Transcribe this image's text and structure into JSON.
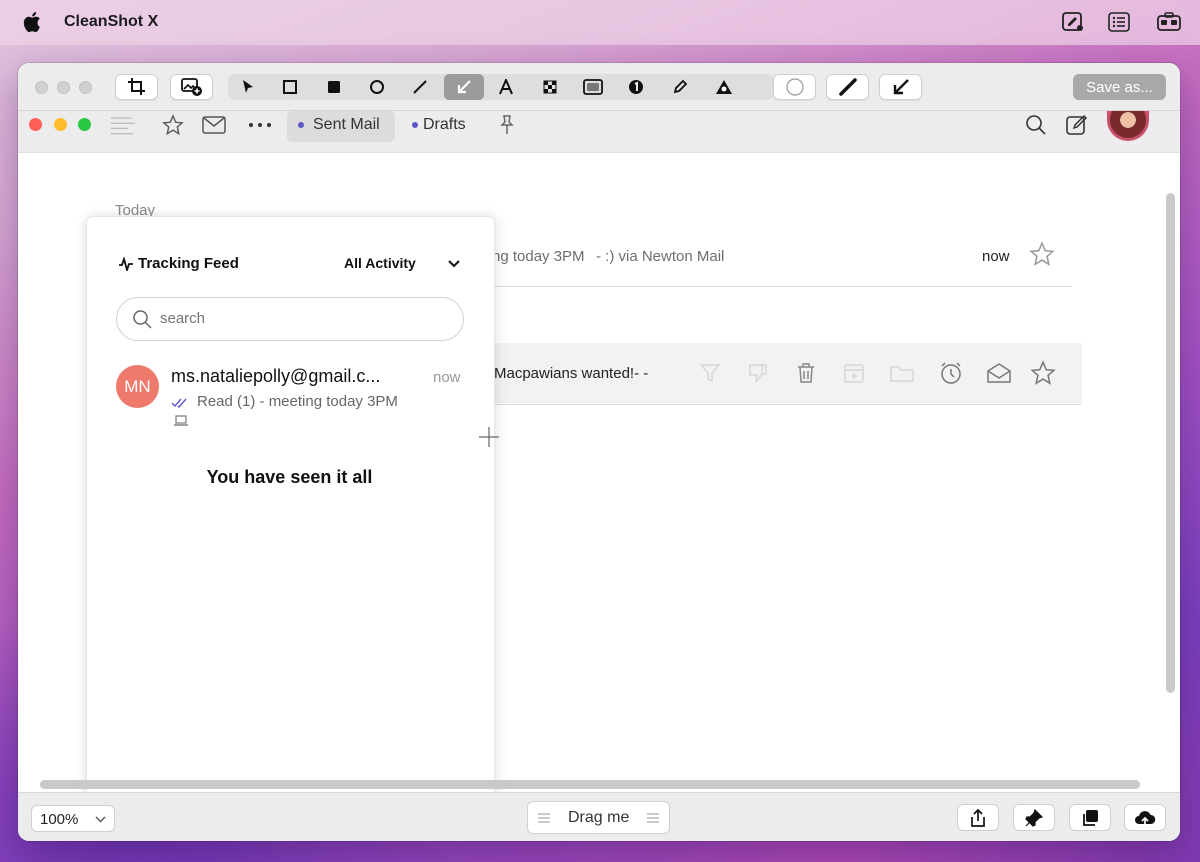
{
  "menubar": {
    "app_name": "CleanShot X",
    "icons": [
      "annotate-icon",
      "list-icon",
      "toolbox-icon"
    ]
  },
  "toolbar": {
    "tools": [
      "crop-icon",
      "add-background-icon",
      "select-arrow-icon",
      "rectangle-icon",
      "filled-rectangle-icon",
      "ellipse-icon",
      "line-icon",
      "arrow-icon",
      "text-icon",
      "pixelate-icon",
      "highlight-box-icon",
      "counter-icon",
      "pencil-icon",
      "blur-icon",
      "color-icon",
      "stroke-width-icon",
      "arrow-style-icon"
    ],
    "active_tool": "arrow-icon",
    "save_label": "Save as..."
  },
  "mail": {
    "tabs": [
      {
        "label": "Sent Mail",
        "active": true
      },
      {
        "label": "Drafts",
        "active": false
      }
    ],
    "section_label": "Today",
    "rows": [
      {
        "snippet": "ng today 3PM",
        "preview": "- :) via Newton Mail",
        "time": "now"
      },
      {
        "subject": "Macpawians wanted!- -"
      }
    ],
    "row_actions": [
      "filter-icon",
      "thumbs-down-icon",
      "trash-icon",
      "archive-icon",
      "folder-icon",
      "alarm-icon",
      "open-envelope-icon",
      "star-icon"
    ]
  },
  "tracking": {
    "title": "Tracking Feed",
    "filter": "All Activity",
    "search_placeholder": "search",
    "entry": {
      "initials": "MN",
      "email": "ms.nataliepolly@gmail.c...",
      "time": "now",
      "status": "Read (1) - meeting today 3PM"
    },
    "end_message": "You have seen it all"
  },
  "footer": {
    "zoom": "100%",
    "drag_label": "Drag me"
  },
  "colors": {
    "accent_dot": "#5b57c7",
    "avatar_bg": "#ef7a6b",
    "traffic_red": "#fe5f57",
    "traffic_yellow": "#febc2e",
    "traffic_green": "#28c840"
  }
}
